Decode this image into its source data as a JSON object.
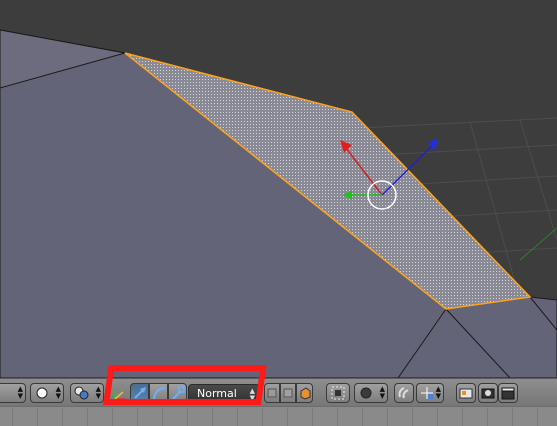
{
  "viewport": {
    "background_color": "#3d3d3d",
    "mesh_face_color": "#646478",
    "selected_face_color": "#b4b4b4",
    "selection_outline_color": "#ffa31a",
    "grid_color": "#4d4d4d"
  },
  "header": {
    "orientation_select": {
      "value": "Normal"
    },
    "icons": {
      "pivot": "pivot-dot-icon",
      "snap": "snap-spheres-icon",
      "manipulator_toggle": "manipulator-axes-icon",
      "translate": "translate-arrow-icon",
      "rotate": "rotate-arc-icon",
      "scale": "scale-corner-icon",
      "vertex_select": "vertex-select-icon",
      "edge_select": "edge-select-icon",
      "face_select": "face-select-icon",
      "occlude": "limit-selection-icon",
      "proportional": "proportional-edit-icon",
      "snap_magnet": "snap-magnet-icon",
      "snap_target": "snap-target-icon",
      "opengl_render": "opengl-render-icon",
      "render_image": "camera-render-icon",
      "render_anim": "clapperboard-render-icon"
    }
  },
  "annotation": {
    "highlight_color": "#ff1a1a"
  }
}
